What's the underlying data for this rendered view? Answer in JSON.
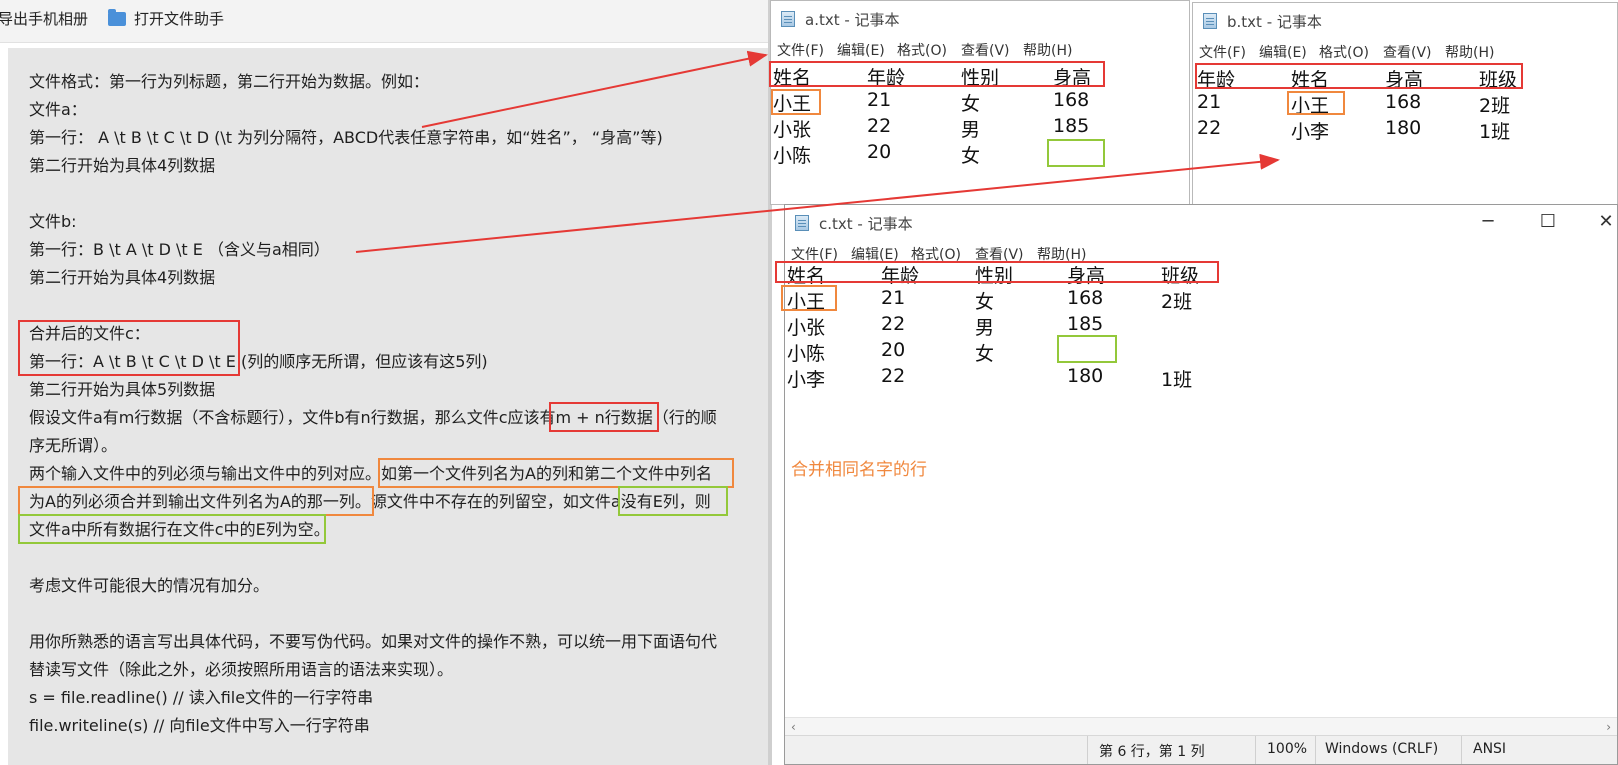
{
  "left": {
    "toolbar": {
      "export_label": "导出手机相册",
      "open_helper_label": "打开文件助手"
    },
    "lines": [
      "文件格式：第一行为列标题，第二行开始为数据。例如：",
      "文件a：",
      "第一行： A \\t B \\t C \\t D    (\\t 为列分隔符，ABCD代表任意字符串，如“姓名”，  “身高”等)",
      "第二行开始为具体4列数据",
      "文件b:",
      "第一行：B \\t A \\t D \\t E   （含义与a相同）",
      "第二行开始为具体4列数据",
      "合并后的文件c：",
      "第一行：A \\t B \\t C \\t D \\t E (列的顺序无所谓，但应该有这5列)",
      "第二行开始为具体5列数据",
      "假设文件a有m行数据（不含标题行），文件b有n行数据，那么文件c应该有m + n行数据（行的顺",
      "序无所谓）。",
      "两个输入文件中的列必须与输出文件中的列对应。如第一个文件列名为A的列和第二个文件中列名",
      "为A的列必须合并到输出文件列名为A的那一列。源文件中不存在的列留空，如文件a没有E列，则",
      "文件a中所有数据行在文件c中的E列为空。",
      "考虑文件可能很大的情况有加分。",
      "用你所熟悉的语言写出具体代码，不要写伪代码。如果对文件的操作不熟，可以统一用下面语句代",
      "替读写文件（除此之外，必须按照所用语言的语法来实现）。",
      "s = file.readline()   // 读入file文件的一行字符串",
      "file.writeline(s)  // 向file文件中写入一行字符串"
    ]
  },
  "menus": [
    "文件(F)",
    "编辑(E)",
    "格式(O)",
    "查看(V)",
    "帮助(H)"
  ],
  "win_a": {
    "title": "a.txt - 记事本",
    "rows": [
      [
        "姓名",
        "年龄",
        "性别",
        "身高"
      ],
      [
        "小王",
        "21",
        "女",
        "168"
      ],
      [
        "小张",
        "22",
        "男",
        "185"
      ],
      [
        "小陈",
        "20",
        "女",
        ""
      ]
    ]
  },
  "win_b": {
    "title": "b.txt - 记事本",
    "rows": [
      [
        "年龄",
        "姓名",
        "身高",
        "班级"
      ],
      [
        "21",
        "小王",
        "168",
        "2班"
      ],
      [
        "22",
        "小李",
        "180",
        "1班"
      ]
    ]
  },
  "win_c": {
    "title": "c.txt - 记事本",
    "rows": [
      [
        "姓名",
        "年龄",
        "性别",
        "身高",
        "班级"
      ],
      [
        "小王",
        "21",
        "女",
        "168",
        "2班"
      ],
      [
        "小张",
        "22",
        "男",
        "185",
        ""
      ],
      [
        "小陈",
        "20",
        "女",
        "",
        ""
      ],
      [
        "小李",
        "22",
        "",
        "180",
        "1班"
      ]
    ],
    "note": "合并相同名字的行",
    "status": {
      "position": "第 6 行，第 1 列",
      "zoom": "100%",
      "line_ending": "Windows (CRLF)",
      "encoding": "ANSI"
    },
    "controls": {
      "minimize": "─",
      "maximize": "☐",
      "close": "✕"
    }
  },
  "colors": {
    "annotation_red": "#e53935",
    "annotation_orange": "#f0883e",
    "annotation_green": "#93c83a"
  }
}
